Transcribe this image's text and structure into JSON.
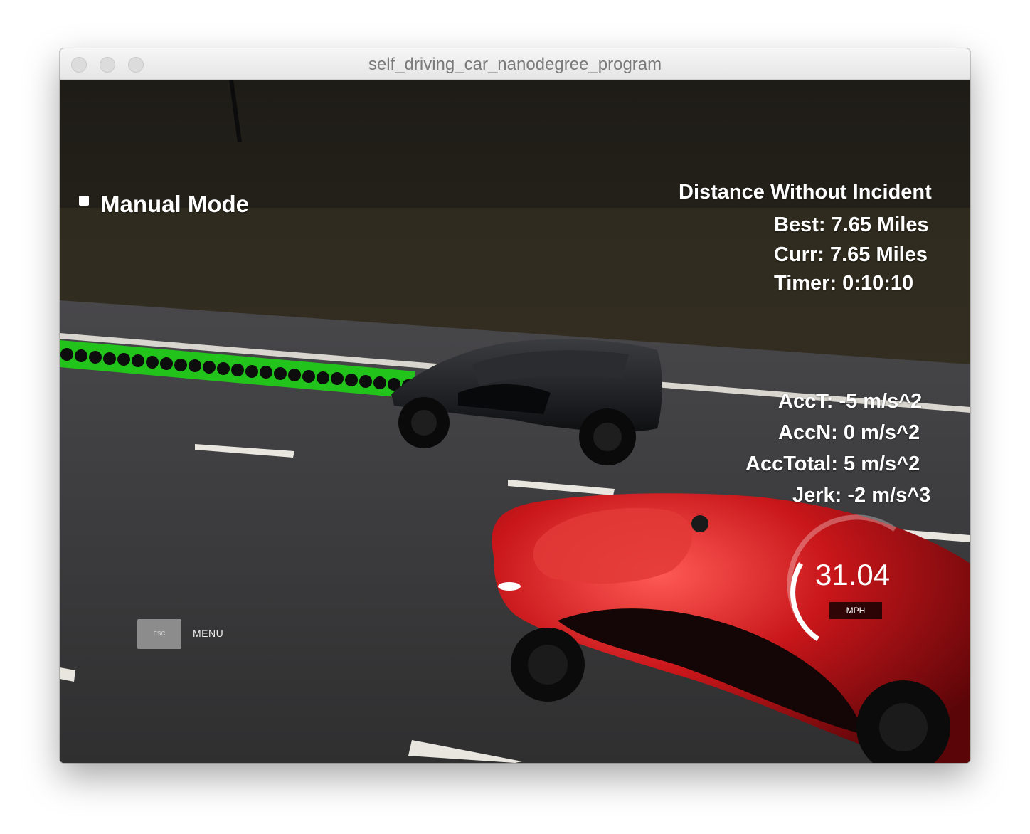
{
  "window": {
    "title": "self_driving_car_nanodegree_program"
  },
  "hud": {
    "manual_mode": {
      "label": "Manual Mode",
      "checked": false
    },
    "distance": {
      "heading": "Distance Without Incident",
      "best": "Best: 7.65 Miles",
      "curr": "Curr: 7.65 Miles",
      "timer": "Timer: 0:10:10"
    },
    "acceleration": {
      "acc_t": "AccT: -5 m/s^2",
      "acc_n": "AccN: 0 m/s^2",
      "acc_total": "AccTotal: 5 m/s^2",
      "jerk": "Jerk: -2 m/s^3"
    },
    "speedometer": {
      "value": "31.04",
      "unit": "MPH",
      "level": 0.4
    },
    "menu": {
      "key_label": "ESC",
      "label": "MENU"
    }
  },
  "colors": {
    "road": "#3c3b38",
    "lane_marking": "#e8e6df",
    "planned_path": "#22c41c",
    "ego_car": "#c8161a",
    "other_car": "#1c1d1f",
    "ground": "#2e2a21"
  }
}
